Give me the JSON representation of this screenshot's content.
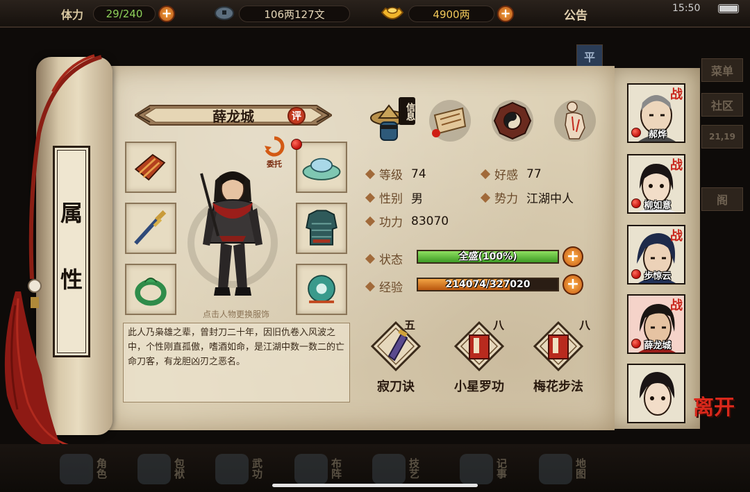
{
  "topbar": {
    "stamina_label": "体力",
    "stamina_value": "29/240",
    "money_value": "106两127文",
    "ingot_value": "4900两",
    "notice_label": "公告",
    "clock": "15:50",
    "battery_percent": 100
  },
  "side_menu": [
    "平",
    "菜单",
    "社区",
    "21,19",
    "阁"
  ],
  "scroll": {
    "label_chars": [
      "属",
      "性"
    ]
  },
  "character": {
    "name": "薛龙城",
    "review_badge": "评",
    "entrust_label": "委托",
    "hint": "点击人物更换服饰",
    "bio": "此人乃枭雄之辈，曾封刀二十年，因旧仇卷入风波之中，个性刚直孤傲，嗜酒如命，是江湖中数一数二的亡命刀客，有龙胆凶刃之恶名。"
  },
  "info_tabs": {
    "active_tag": "信息",
    "tabs": [
      "info-hat-icon",
      "scroll-icon",
      "bagua-icon",
      "meridian-icon"
    ]
  },
  "stats": {
    "level_label": "等级",
    "level_value": "74",
    "favor_label": "好感",
    "favor_value": "77",
    "gender_label": "性别",
    "gender_value": "男",
    "faction_label": "势力",
    "faction_value": "江湖中人",
    "power_label": "功力",
    "power_value": "83070",
    "status_label": "状态",
    "status_text": "全盛(100%)",
    "status_fraction": 1.0,
    "exp_label": "经验",
    "exp_text": "214074/327020",
    "exp_fraction": 0.655
  },
  "skills": [
    {
      "name": "寂刀诀",
      "level": "五"
    },
    {
      "name": "小星罗功",
      "level": "八"
    },
    {
      "name": "梅花步法",
      "level": "八"
    }
  ],
  "roster": [
    {
      "name": "郝烨",
      "tag": "战"
    },
    {
      "name": "柳如意",
      "tag": "战"
    },
    {
      "name": "步惊云",
      "tag": "战"
    },
    {
      "name": "薛龙城",
      "tag": "战"
    },
    {
      "name": "",
      "tag": ""
    }
  ],
  "leave_label": "离开",
  "bottom_menu": [
    "角色",
    "包袱",
    "武功",
    "布阵",
    "技艺",
    "记事",
    "地图"
  ],
  "colors": {
    "status_bar": "#5fb83a",
    "exp_bar": "#d97a1e",
    "accent_red": "#c9241a",
    "paper": "#ddd1b6"
  }
}
